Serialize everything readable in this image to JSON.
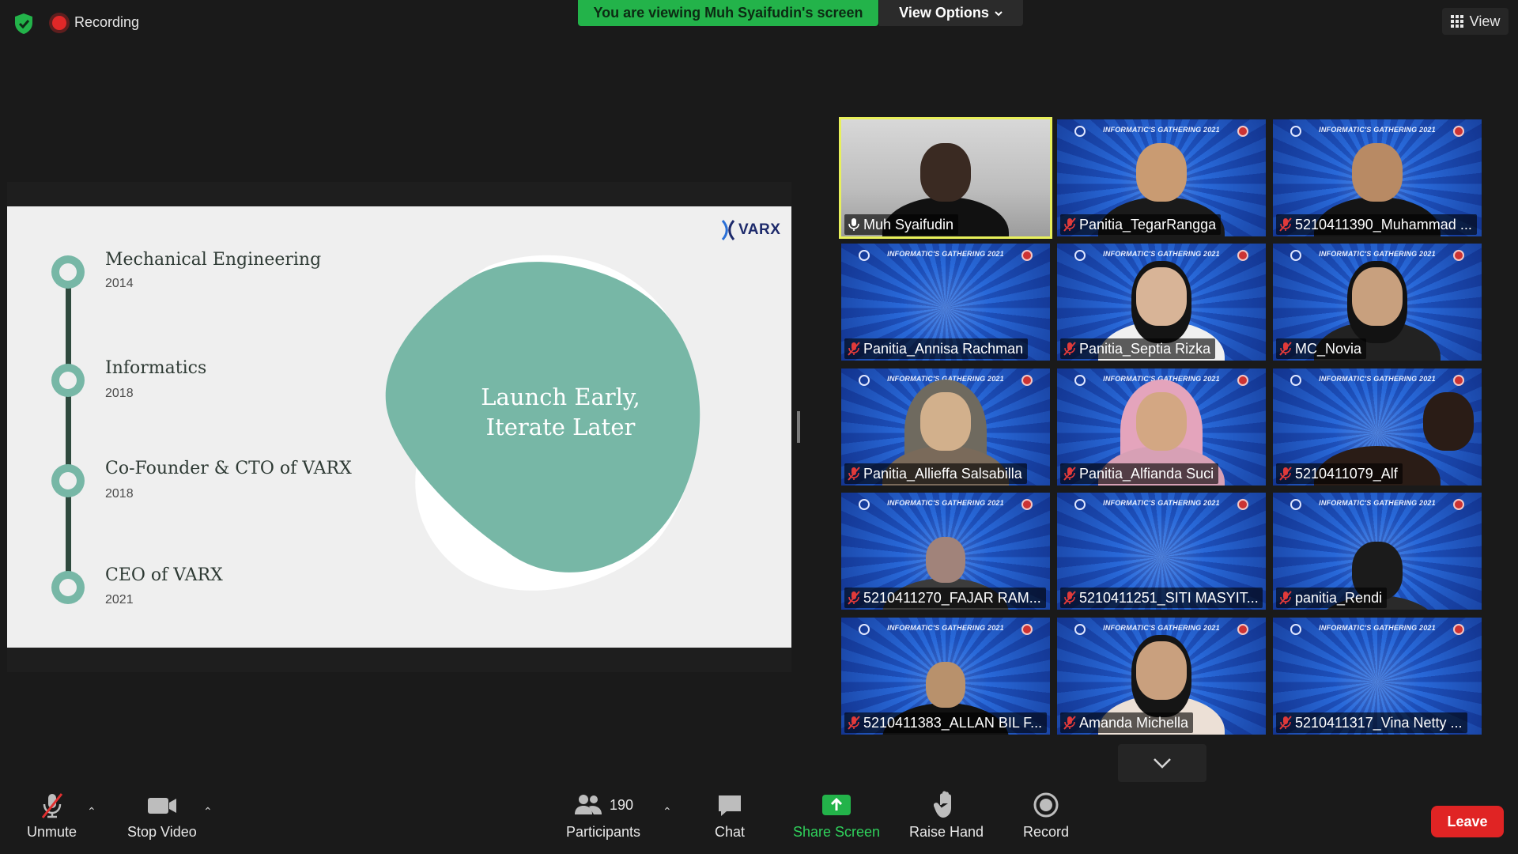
{
  "topbar": {
    "recording_label": "Recording",
    "viewing_banner": "You are viewing Muh Syaifudin's screen",
    "view_options_label": "View Options",
    "view_button_label": "View"
  },
  "slide": {
    "logo_text": "VARX",
    "timeline": [
      {
        "title": "Mechanical Engineering",
        "year": "2014"
      },
      {
        "title": "Informatics",
        "year": "2018"
      },
      {
        "title": "Co-Founder & CTO of VARX",
        "year": "2018"
      },
      {
        "title": "CEO of VARX",
        "year": "2021"
      }
    ],
    "slogan_line1": "Launch Early,",
    "slogan_line2": "Iterate Later",
    "blob_color": "#77b7a6"
  },
  "gallery": {
    "event_title": "INFORMATIC'S GATHERING 2021",
    "active_color": "#e8f05a",
    "participants": [
      {
        "name": "Muh Syaifudin",
        "muted": false,
        "pinned": true
      },
      {
        "name": "Panitia_TegarRangga",
        "muted": true
      },
      {
        "name": "5210411390_Muhammad ...",
        "muted": true
      },
      {
        "name": "Panitia_Annisa Rachman",
        "muted": true
      },
      {
        "name": "Panitia_Septia Rizka",
        "muted": true
      },
      {
        "name": "MC_Novia",
        "muted": true
      },
      {
        "name": "Panitia_Allieffa Salsabilla",
        "muted": true
      },
      {
        "name": "Panitia_Alfianda Suci",
        "muted": true
      },
      {
        "name": "5210411079_Alf",
        "muted": true
      },
      {
        "name": "5210411270_FAJAR RAM...",
        "muted": true
      },
      {
        "name": "5210411251_SITI MASYIT...",
        "muted": true
      },
      {
        "name": "panitia_Rendi",
        "muted": true
      },
      {
        "name": "5210411383_ALLAN BIL F...",
        "muted": true
      },
      {
        "name": "Amanda Michella",
        "muted": true
      },
      {
        "name": "5210411317_Vina Netty ...",
        "muted": true
      }
    ]
  },
  "toolbar": {
    "unmute_label": "Unmute",
    "stop_video_label": "Stop Video",
    "participants_label": "Participants",
    "participants_count": "190",
    "chat_label": "Chat",
    "share_screen_label": "Share Screen",
    "raise_hand_label": "Raise Hand",
    "record_label": "Record",
    "leave_label": "Leave",
    "share_color": "#23b34a",
    "leave_color": "#e02424"
  }
}
